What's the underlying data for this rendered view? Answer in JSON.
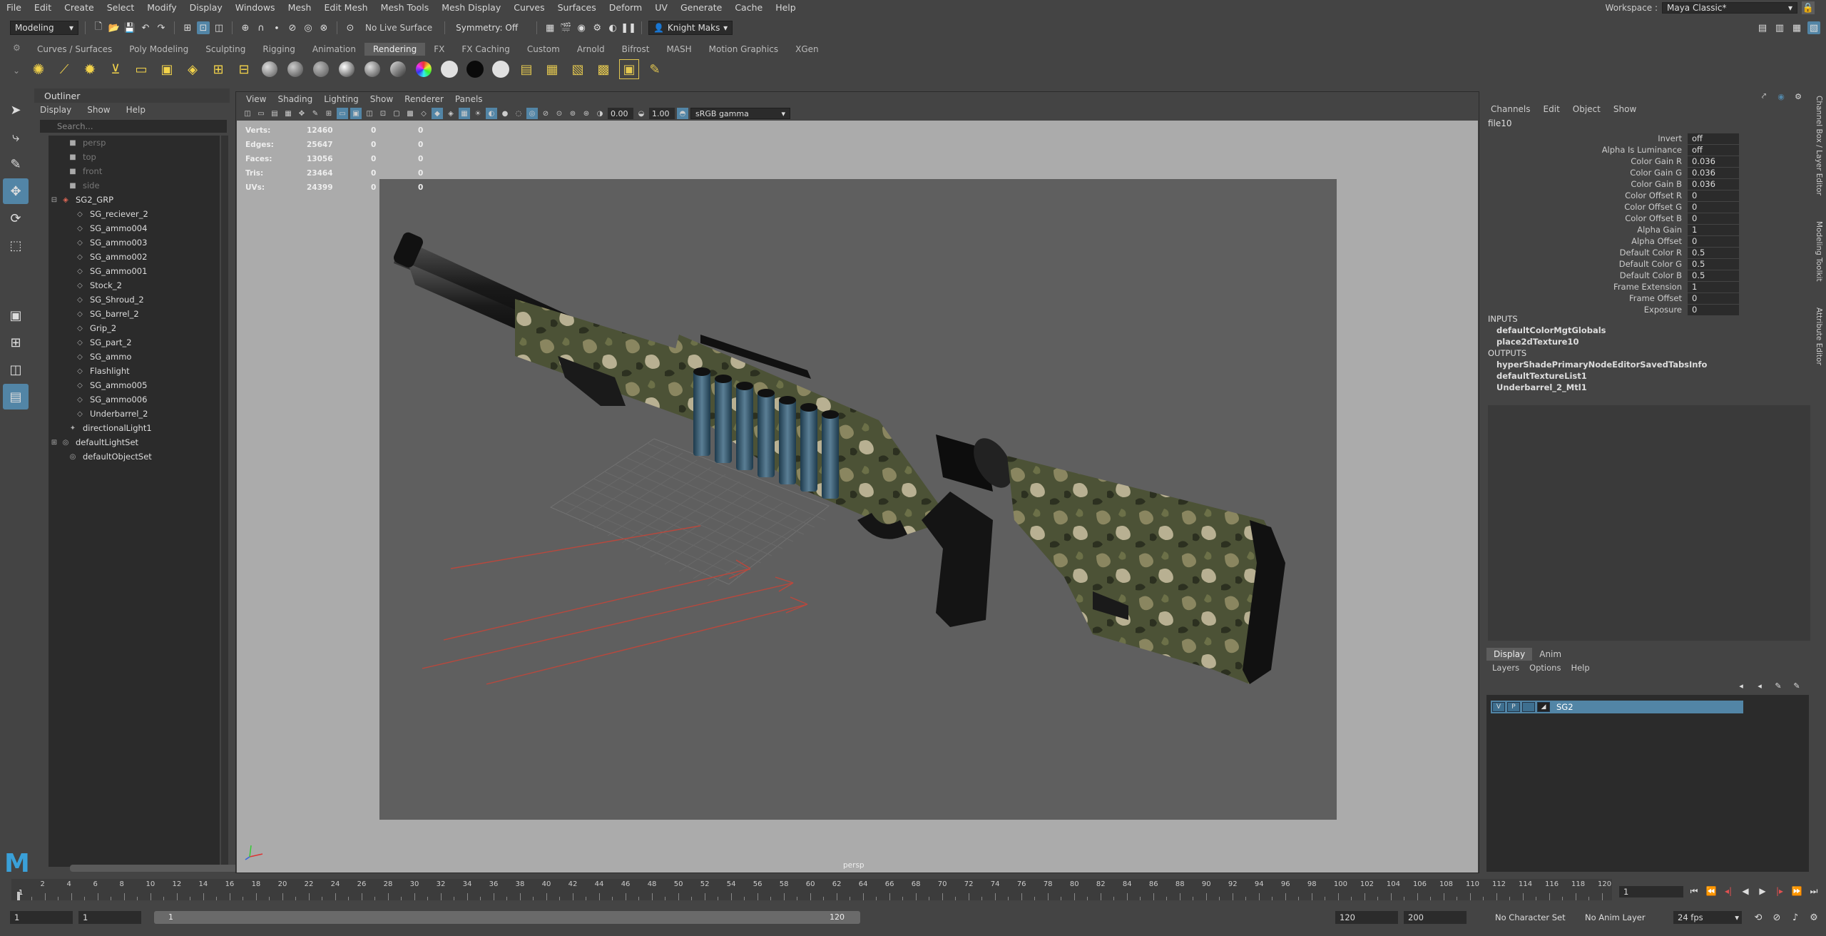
{
  "menubar": [
    "File",
    "Edit",
    "Create",
    "Select",
    "Modify",
    "Display",
    "Windows",
    "Mesh",
    "Edit Mesh",
    "Mesh Tools",
    "Mesh Display",
    "Curves",
    "Surfaces",
    "Deform",
    "UV",
    "Generate",
    "Cache",
    "Help"
  ],
  "workspace": {
    "label": "Workspace :",
    "value": "Maya Classic*"
  },
  "statusline": {
    "mode": "Modeling",
    "live_surface": "No Live Surface",
    "symmetry": "Symmetry: Off",
    "user": "Knight Maks"
  },
  "shelf_tabs": [
    "Curves / Surfaces",
    "Poly Modeling",
    "Sculpting",
    "Rigging",
    "Animation",
    "Rendering",
    "FX",
    "FX Caching",
    "Custom",
    "Arnold",
    "Bifrost",
    "MASH",
    "Motion Graphics",
    "XGen"
  ],
  "shelf_active": "Rendering",
  "outliner": {
    "title": "Outliner",
    "menu": [
      "Display",
      "Show",
      "Help"
    ],
    "search_placeholder": "Search...",
    "items": [
      {
        "label": "persp",
        "dim": true,
        "indent": 1,
        "icon": "camera"
      },
      {
        "label": "top",
        "dim": true,
        "indent": 1,
        "icon": "camera"
      },
      {
        "label": "front",
        "dim": true,
        "indent": 1,
        "icon": "camera"
      },
      {
        "label": "side",
        "dim": true,
        "indent": 1,
        "icon": "camera"
      },
      {
        "label": "SG2_GRP",
        "dim": false,
        "indent": 0,
        "icon": "group",
        "expander": "minus"
      },
      {
        "label": "SG_reciever_2",
        "dim": false,
        "indent": 2,
        "icon": "mesh"
      },
      {
        "label": "SG_ammo004",
        "dim": false,
        "indent": 2,
        "icon": "mesh"
      },
      {
        "label": "SG_ammo003",
        "dim": false,
        "indent": 2,
        "icon": "mesh"
      },
      {
        "label": "SG_ammo002",
        "dim": false,
        "indent": 2,
        "icon": "mesh"
      },
      {
        "label": "SG_ammo001",
        "dim": false,
        "indent": 2,
        "icon": "mesh"
      },
      {
        "label": "Stock_2",
        "dim": false,
        "indent": 2,
        "icon": "mesh"
      },
      {
        "label": "SG_Shroud_2",
        "dim": false,
        "indent": 2,
        "icon": "mesh"
      },
      {
        "label": "SG_barrel_2",
        "dim": false,
        "indent": 2,
        "icon": "mesh"
      },
      {
        "label": "Grip_2",
        "dim": false,
        "indent": 2,
        "icon": "mesh"
      },
      {
        "label": "SG_part_2",
        "dim": false,
        "indent": 2,
        "icon": "mesh"
      },
      {
        "label": "SG_ammo",
        "dim": false,
        "indent": 2,
        "icon": "mesh"
      },
      {
        "label": "Flashlight",
        "dim": false,
        "indent": 2,
        "icon": "mesh"
      },
      {
        "label": "SG_ammo005",
        "dim": false,
        "indent": 2,
        "icon": "mesh"
      },
      {
        "label": "SG_ammo006",
        "dim": false,
        "indent": 2,
        "icon": "mesh"
      },
      {
        "label": "Underbarrel_2",
        "dim": false,
        "indent": 2,
        "icon": "mesh"
      },
      {
        "label": "directionalLight1",
        "dim": false,
        "indent": 1,
        "icon": "light"
      },
      {
        "label": "defaultLightSet",
        "dim": false,
        "indent": 0,
        "icon": "set",
        "expander": "plus"
      },
      {
        "label": "defaultObjectSet",
        "dim": false,
        "indent": 1,
        "icon": "set"
      }
    ]
  },
  "viewport": {
    "menu": [
      "View",
      "Shading",
      "Lighting",
      "Show",
      "Renderer",
      "Panels"
    ],
    "exposure": "0.00",
    "gamma": "1.00",
    "color_space": "sRGB gamma",
    "camera": "persp",
    "hud": [
      {
        "label": "Verts:",
        "value": "12460",
        "a": "0",
        "b": "0"
      },
      {
        "label": "Edges:",
        "value": "25647",
        "a": "0",
        "b": "0"
      },
      {
        "label": "Faces:",
        "value": "13056",
        "a": "0",
        "b": "0"
      },
      {
        "label": "Tris:",
        "value": "23464",
        "a": "0",
        "b": "0"
      },
      {
        "label": "UVs:",
        "value": "24399",
        "a": "0",
        "b": "0"
      }
    ]
  },
  "channelbox": {
    "menu": [
      "Channels",
      "Edit",
      "Object",
      "Show"
    ],
    "node": "file10",
    "attrs": [
      {
        "name": "Invert",
        "value": "off"
      },
      {
        "name": "Alpha Is Luminance",
        "value": "off"
      },
      {
        "name": "Color Gain R",
        "value": "0.036"
      },
      {
        "name": "Color Gain G",
        "value": "0.036"
      },
      {
        "name": "Color Gain B",
        "value": "0.036"
      },
      {
        "name": "Color Offset R",
        "value": "0"
      },
      {
        "name": "Color Offset G",
        "value": "0"
      },
      {
        "name": "Color Offset B",
        "value": "0"
      },
      {
        "name": "Alpha Gain",
        "value": "1"
      },
      {
        "name": "Alpha Offset",
        "value": "0"
      },
      {
        "name": "Default Color R",
        "value": "0.5"
      },
      {
        "name": "Default Color G",
        "value": "0.5"
      },
      {
        "name": "Default Color B",
        "value": "0.5"
      },
      {
        "name": "Frame Extension",
        "value": "1"
      },
      {
        "name": "Frame Offset",
        "value": "0"
      },
      {
        "name": "Exposure",
        "value": "0"
      }
    ],
    "inputs_label": "INPUTS",
    "inputs": [
      "defaultColorMgtGlobals",
      "place2dTexture10"
    ],
    "outputs_label": "OUTPUTS",
    "outputs": [
      "hyperShadePrimaryNodeEditorSavedTabsInfo",
      "defaultTextureList1",
      "Underbarrel_2_Mtl1"
    ],
    "side_tabs": [
      "Channel Box / Layer Editor",
      "Modeling Toolkit",
      "Attribute Editor"
    ]
  },
  "layer_editor": {
    "tabs": [
      "Display",
      "Anim"
    ],
    "menu": [
      "Layers",
      "Options",
      "Help"
    ],
    "layer": {
      "v": "V",
      "p": "P",
      "name": "SG2"
    }
  },
  "timeslider": {
    "ticks": [
      "1",
      "2",
      "4",
      "6",
      "8",
      "10",
      "12",
      "14",
      "16",
      "18",
      "20",
      "22",
      "24",
      "26",
      "28",
      "30",
      "32",
      "34",
      "36",
      "38",
      "40",
      "42",
      "44",
      "46",
      "48",
      "50",
      "52",
      "54",
      "56",
      "58",
      "60",
      "62",
      "64",
      "66",
      "68",
      "70",
      "72",
      "74",
      "76",
      "78",
      "80",
      "82",
      "84",
      "86",
      "88",
      "90",
      "92",
      "94",
      "96",
      "98",
      "100",
      "102",
      "104",
      "106",
      "108",
      "110",
      "112",
      "114",
      "116",
      "118",
      "120"
    ],
    "current": "1"
  },
  "range": {
    "start": "1",
    "playback_start": "1",
    "slider_start": "1",
    "slider_end": "120",
    "playback_end": "120",
    "end": "200",
    "character_set": "No Character Set",
    "anim_layer": "No Anim Layer",
    "fps": "24 fps"
  },
  "colors": {
    "accent": "#5285a6",
    "panel": "#444444",
    "field": "#2b2b2b",
    "viewport_bg": "#ababab"
  }
}
